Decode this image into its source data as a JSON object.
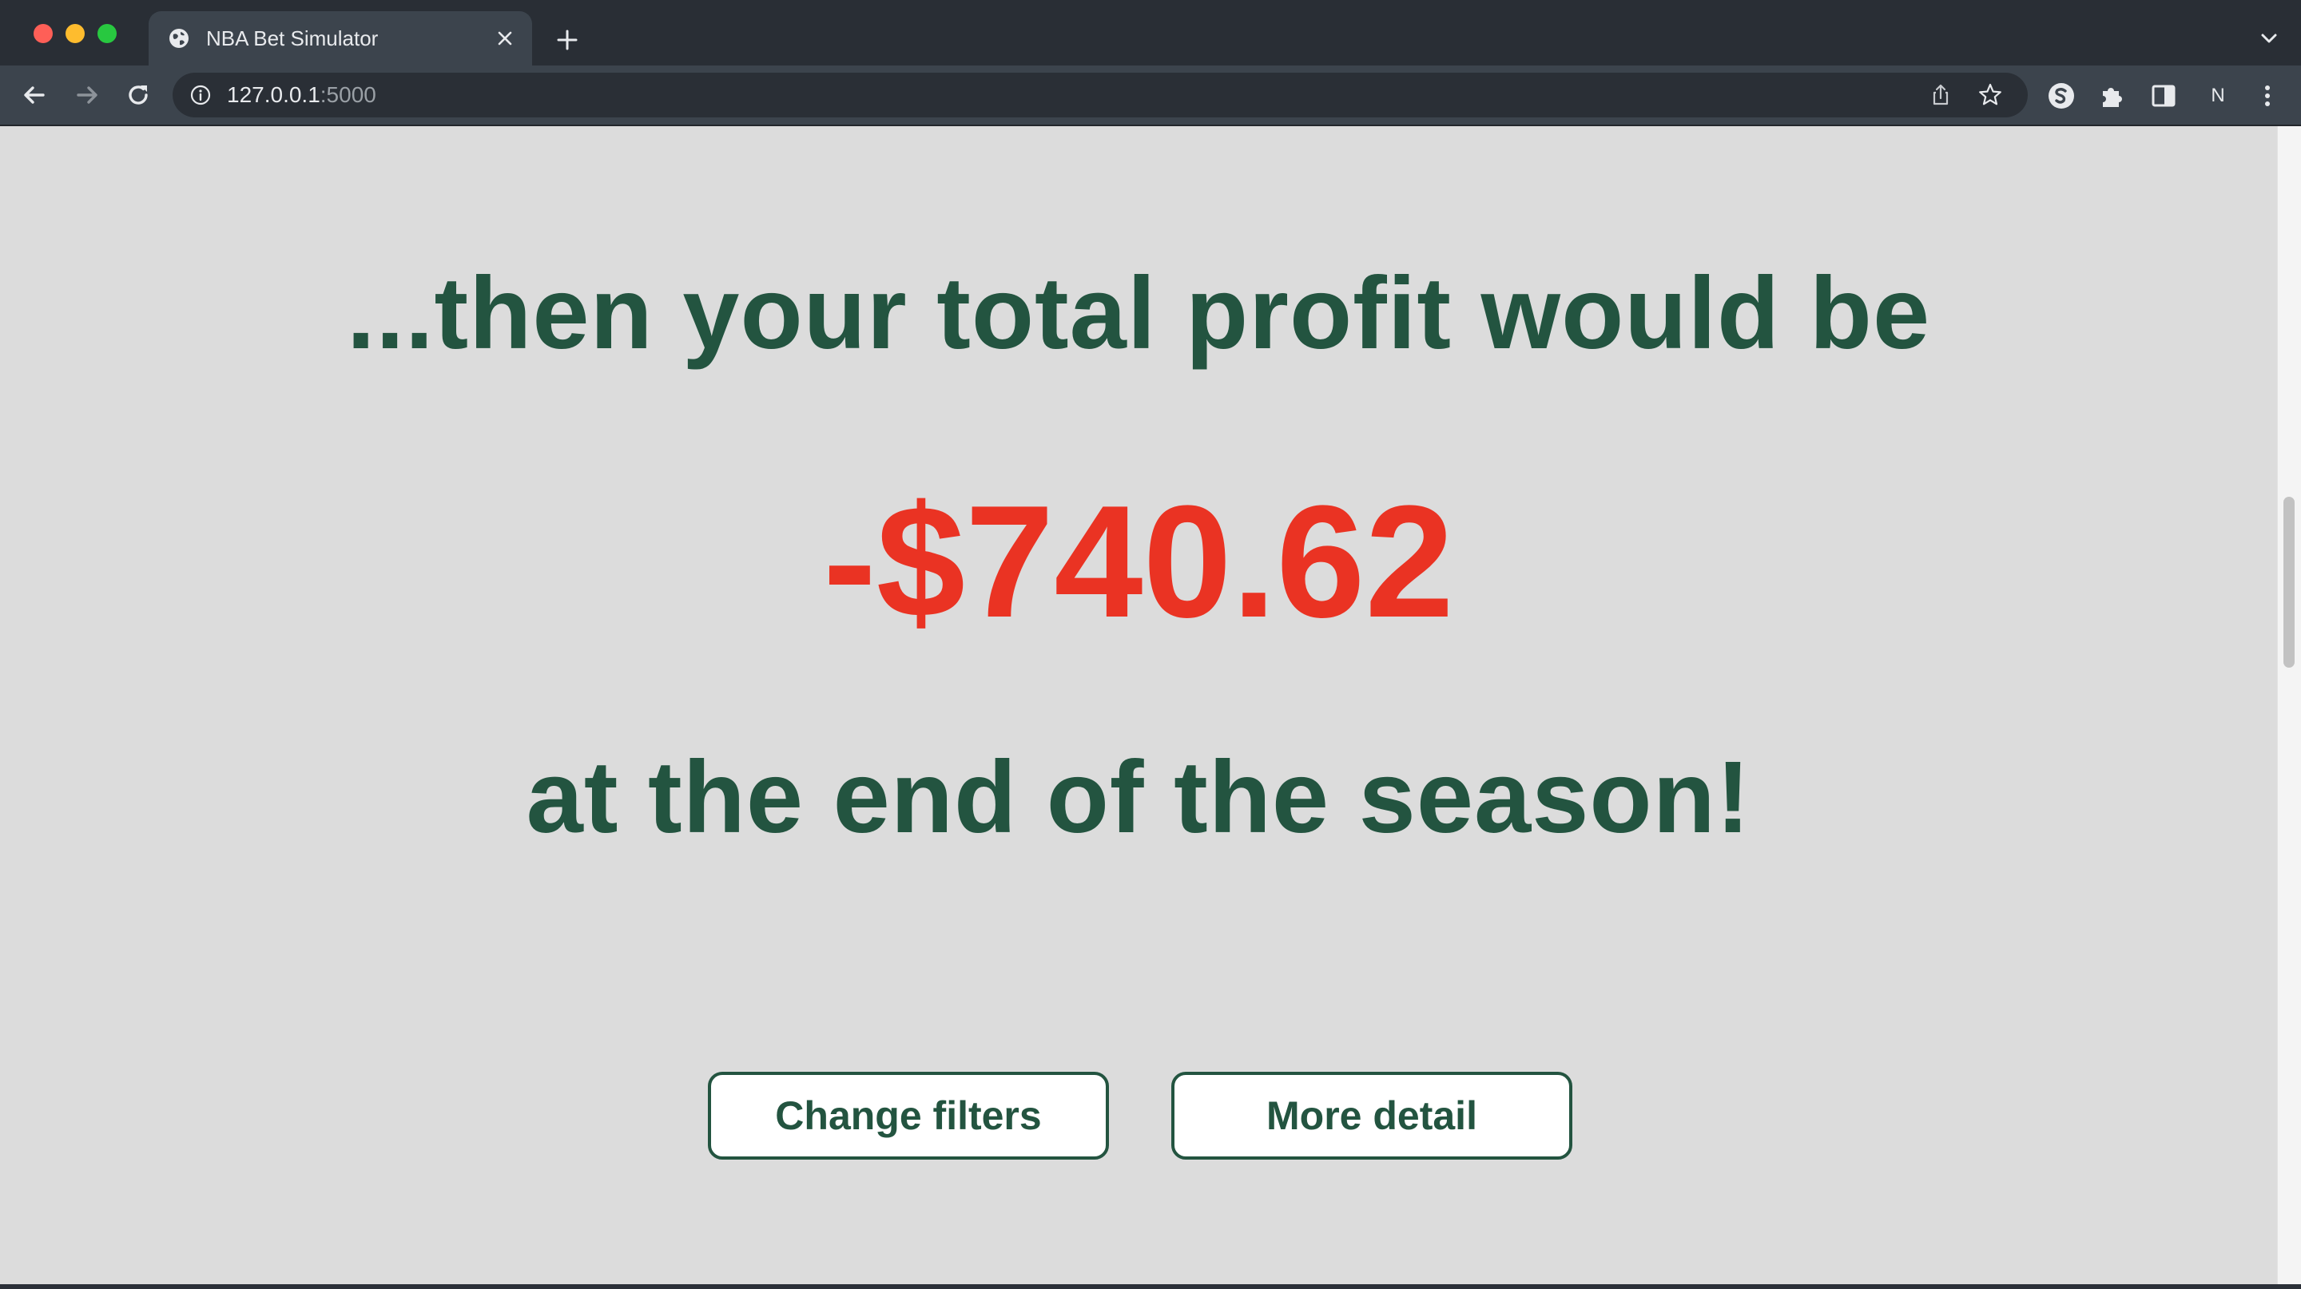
{
  "browser": {
    "tab_title": "NBA Bet Simulator",
    "url_host": "127.0.0.1",
    "url_port": ":5000",
    "profile_initial": "N"
  },
  "page": {
    "intro_text": "...then your total profit would be",
    "profit_amount": "-$740.62",
    "outro_text": "at the end of the season!",
    "change_filters_label": "Change filters",
    "more_detail_label": "More detail"
  },
  "colors": {
    "heading_green": "#235440",
    "negative_red": "#ea3323",
    "page_background": "#dcdcdc"
  },
  "icons": {
    "tab": [
      "globe-icon",
      "close-icon",
      "plus-icon",
      "chevron-down-icon"
    ],
    "toolbar": [
      "back-arrow-icon",
      "forward-arrow-icon",
      "reload-icon",
      "info-icon",
      "share-icon",
      "star-icon",
      "extension-s-icon",
      "puzzle-icon",
      "side-panel-icon",
      "kebab-menu-icon"
    ]
  }
}
